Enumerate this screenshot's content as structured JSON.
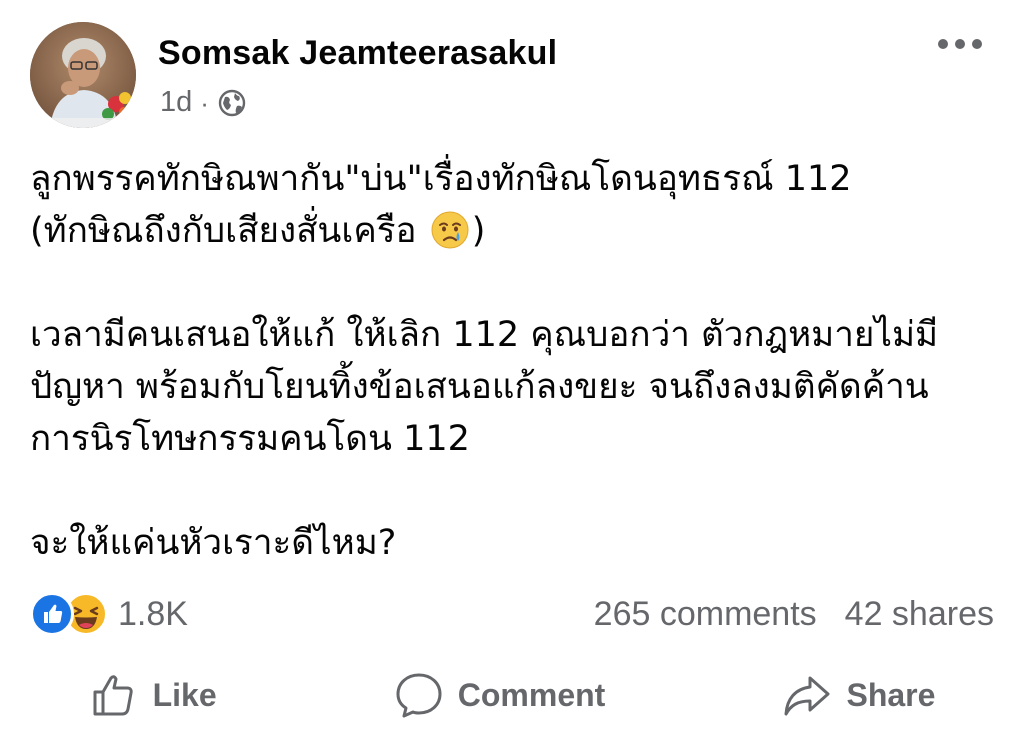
{
  "post": {
    "author": "Somsak Jeamteerasakul",
    "time": "1d",
    "separator": "·",
    "audience_icon": "globe-icon",
    "more_icon": "more-dots-icon",
    "body": {
      "line1": "ลูกพรรคทักษิณพากัน\"บ่น\"เรื่องทักษิณโดนอุทธรณ์ 112",
      "line2_before_emoji": "(ทักษิณถึงกับเสียงสั่นเครือ ",
      "line2_emoji": "crying-face-emoji",
      "line2_after_emoji": ")",
      "para2_line1": "เวลามีคนเสนอให้แก้ ให้เลิก 112 คุณบอกว่า ตัวกฎหมายไม่มี",
      "para2_line2": "ปัญหา พร้อมกับโยนทิ้งข้อเสนอแก้ลงขยะ จนถึงลงมติคัดค้าน",
      "para2_line3": "การนิรโทษกรรมคนโดน 112",
      "para3": "จะให้แค่นหัวเราะดีไหม?"
    },
    "reactions": {
      "icons": [
        "like-reaction-icon",
        "haha-reaction-icon"
      ],
      "count": "1.8K"
    },
    "comments": "265 comments",
    "shares": "42 shares",
    "actions": {
      "like": "Like",
      "comment": "Comment",
      "share": "Share"
    },
    "colors": {
      "text": "#050505",
      "secondary": "#65676b",
      "like_blue": "#1b74e4",
      "haha_yellow": "#f7b928"
    }
  }
}
